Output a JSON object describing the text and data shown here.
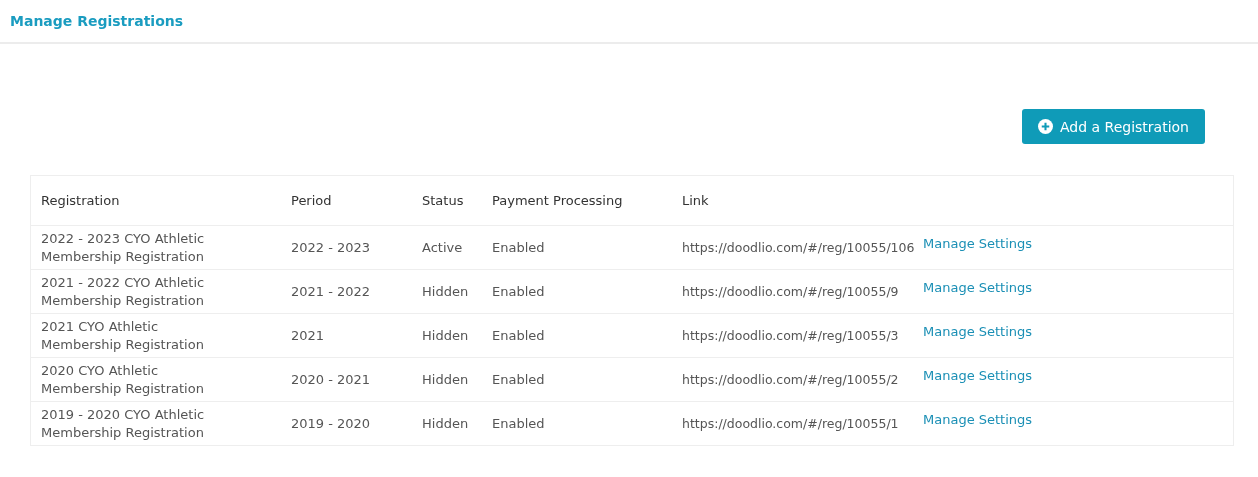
{
  "header": {
    "title": "Manage Registrations"
  },
  "add_button": {
    "label": "Add a Registration"
  },
  "table": {
    "columns": [
      "Registration",
      "Period",
      "Status",
      "Payment Processing",
      "Link"
    ],
    "rows": [
      {
        "registration": "2022 - 2023 CYO Athletic Membership Registration",
        "period": "2022 - 2023",
        "status": "Active",
        "payment_processing": "Enabled",
        "link": "https://doodlio.com/#/reg/10055/106",
        "action": "Manage Settings"
      },
      {
        "registration": "2021 - 2022 CYO Athletic Membership Registration",
        "period": "2021 - 2022",
        "status": "Hidden",
        "payment_processing": "Enabled",
        "link": "https://doodlio.com/#/reg/10055/9",
        "action": "Manage Settings"
      },
      {
        "registration": "2021 CYO Athletic Membership Registration",
        "period": "2021",
        "status": "Hidden",
        "payment_processing": "Enabled",
        "link": "https://doodlio.com/#/reg/10055/3",
        "action": "Manage Settings"
      },
      {
        "registration": "2020 CYO Athletic Membership Registration",
        "period": "2020 - 2021",
        "status": "Hidden",
        "payment_processing": "Enabled",
        "link": "https://doodlio.com/#/reg/10055/2",
        "action": "Manage Settings"
      },
      {
        "registration": "2019 - 2020 CYO Athletic Membership Registration",
        "period": "2019 - 2020",
        "status": "Hidden",
        "payment_processing": "Enabled",
        "link": "https://doodlio.com/#/reg/10055/1",
        "action": "Manage Settings"
      }
    ]
  }
}
